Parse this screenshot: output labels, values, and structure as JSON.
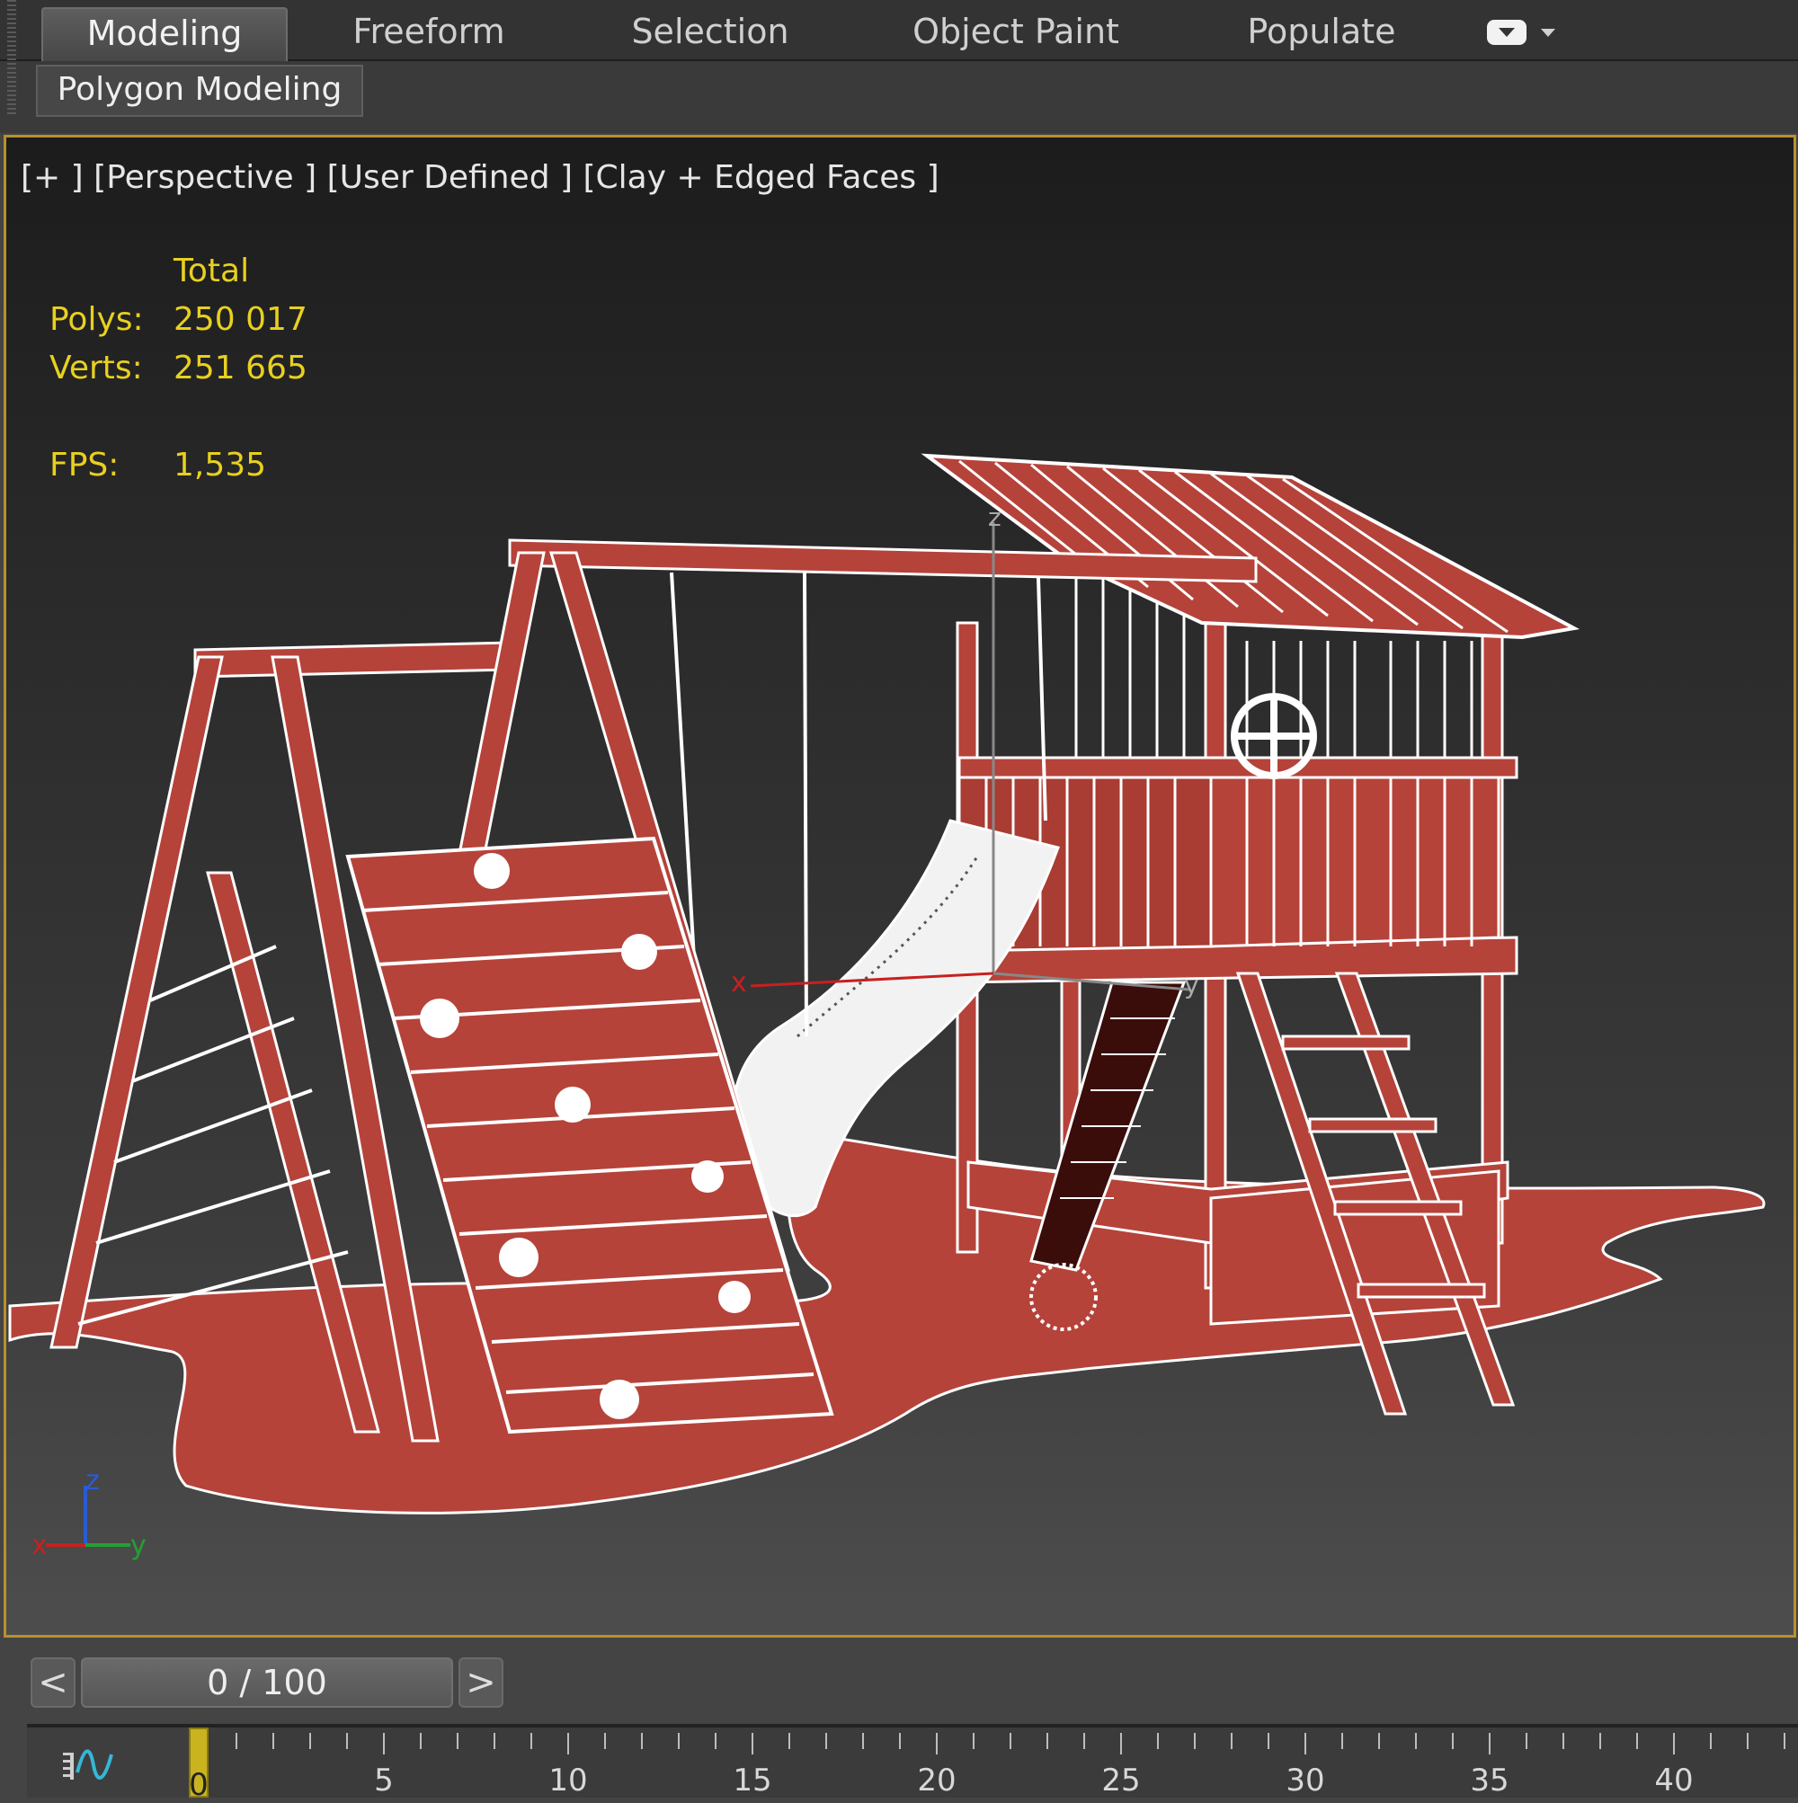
{
  "ribbon": {
    "tabs": [
      "Modeling",
      "Freeform",
      "Selection",
      "Object Paint",
      "Populate"
    ],
    "active_tab": "Modeling",
    "panel_button": "Polygon Modeling"
  },
  "viewport": {
    "label_plus": "[+ ]",
    "label_view": "[Perspective ]",
    "label_lighting": "[User Defined ]",
    "label_shading": "[Clay + Edged Faces ]",
    "stats": {
      "header": "Total",
      "polys_label": "Polys:",
      "polys_value": "250 017",
      "verts_label": "Verts:",
      "verts_value": "251 665",
      "fps_label": "FPS:",
      "fps_value": "1,535"
    },
    "gizmo_labels": {
      "x": "x",
      "y": "y",
      "z": "z"
    },
    "world_axis": {
      "x": "x",
      "y": "y",
      "z": "z"
    },
    "model_color": "#b5433a",
    "edge_color": "#ffffff"
  },
  "timeline": {
    "prev_label": "<",
    "next_label": ">",
    "slider_text": "0 / 100",
    "current_frame": 0,
    "total_frames": 100,
    "ruler_labels": [
      "0",
      "5",
      "10",
      "15",
      "20",
      "25",
      "30",
      "35",
      "40"
    ]
  },
  "colors": {
    "viewport_border": "#b7912b",
    "stats_text": "#e8d020",
    "time_cursor": "#c9b41f"
  }
}
